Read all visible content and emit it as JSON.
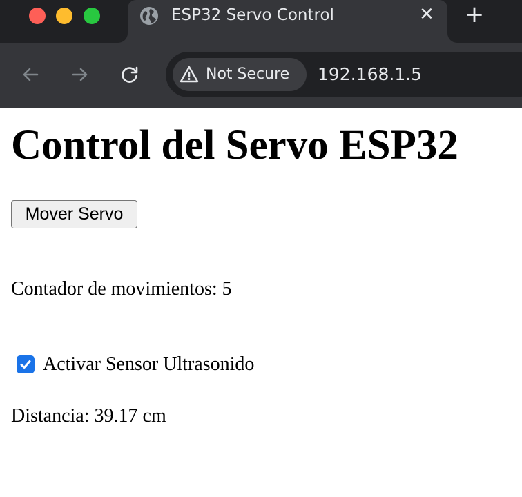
{
  "browser": {
    "tab": {
      "title": "ESP32 Servo Control",
      "favicon": "globe-icon",
      "close": "✕"
    },
    "new_tab": "+",
    "toolbar": {
      "security_label": "Not Secure",
      "security_icon": "warning-icon",
      "url": "192.168.1.5"
    }
  },
  "page": {
    "heading": "Control del Servo ESP32",
    "move_button_label": "Mover Servo",
    "counter_label": "Contador de movimientos:",
    "counter_value": "5",
    "sensor_checkbox_label": "Activar Sensor Ultrasonido",
    "sensor_checked": true,
    "distance_label": "Distancia:",
    "distance_value": "39.17 cm"
  },
  "colors": {
    "tabbar_bg": "#202124",
    "tab_bg": "#35363a",
    "omnibox_bg": "#202124",
    "checkbox_accent": "#1a73e8"
  }
}
